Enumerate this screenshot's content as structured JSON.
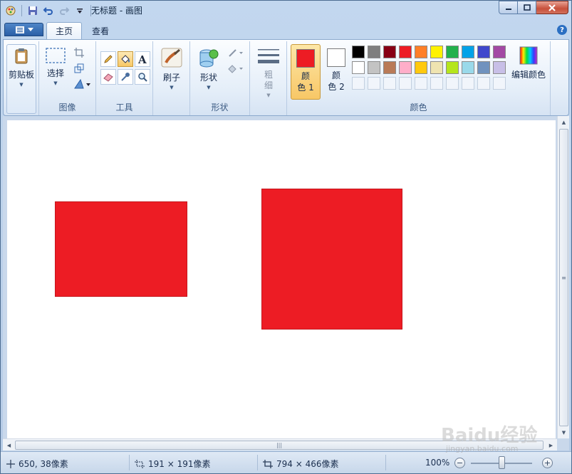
{
  "window": {
    "title": "无标题 - 画图"
  },
  "tabs": {
    "home": "主页",
    "view": "查看"
  },
  "ribbon": {
    "clipboard": {
      "label": "剪贴板"
    },
    "image": {
      "select": "选择",
      "group": "图像"
    },
    "tools": {
      "group": "工具"
    },
    "brush": {
      "label": "刷子"
    },
    "shapes": {
      "label": "形状",
      "group": "形状"
    },
    "size": {
      "label_top": "粗",
      "label_bottom": "细"
    },
    "colors": {
      "color1_top": "颜",
      "color1_bottom": "色 1",
      "color2_top": "颜",
      "color2_bottom": "色 2",
      "edit": "编辑颜色",
      "group": "颜色",
      "color1_value": "#ed1c24",
      "color2_value": "#ffffff",
      "palette": [
        "#000000",
        "#7f7f7f",
        "#880015",
        "#ed1c24",
        "#ff7f27",
        "#fff200",
        "#22b14c",
        "#00a2e8",
        "#3f48cc",
        "#a349a4",
        "#ffffff",
        "#c3c3c3",
        "#b97a57",
        "#ffaec9",
        "#ffc90e",
        "#efe4b0",
        "#b5e61d",
        "#99d9ea",
        "#7092be",
        "#c8bfe7"
      ]
    }
  },
  "canvas": {
    "background": "#ffffff",
    "shapes": [
      {
        "type": "rectangle",
        "fill": "#ed1c24"
      },
      {
        "type": "rectangle",
        "fill": "#ed1c24"
      }
    ]
  },
  "status": {
    "cursor_pos": "650, 38像素",
    "selection_size": "191 × 191像素",
    "image_size": "794 × 466像素",
    "zoom": "100%"
  },
  "watermark": {
    "brand": "Baidu经验",
    "url": "jingyan.baidu.com"
  }
}
